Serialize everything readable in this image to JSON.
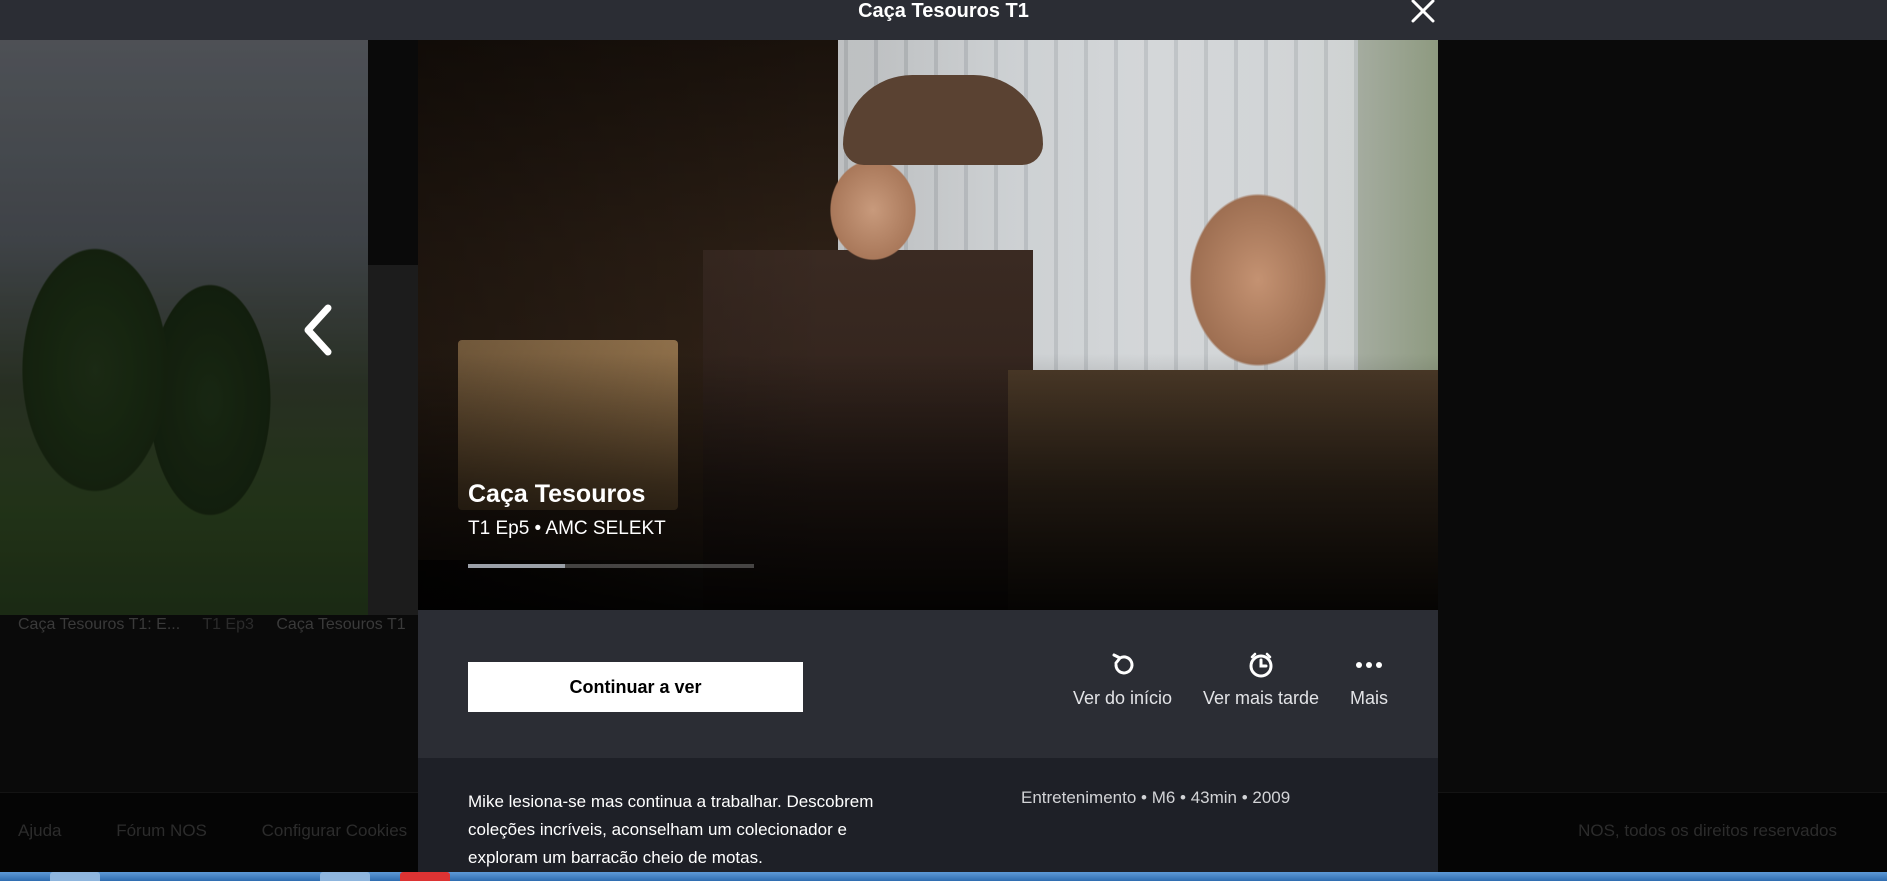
{
  "window": {
    "title": "Caça Tesouros T1",
    "close_label": "Fechar"
  },
  "background": {
    "captions": [
      "Caça Tesouros T1: E...",
      "T1 Ep3",
      "Caça Tesouros T1"
    ],
    "footer_links": [
      "Ajuda",
      "Fórum NOS",
      "Configurar Cookies"
    ],
    "copyright": "NOS, todos os direitos reservados"
  },
  "episode": {
    "show_title": "Caça Tesouros",
    "subtitle": "T1 Ep5 • AMC SELEKT",
    "progress": 0.34,
    "continue_label": "Continuar a ver",
    "actions": [
      {
        "label": "Ver do início",
        "icon": "replay-icon"
      },
      {
        "label": "Ver mais tarde",
        "icon": "watch-later-icon"
      },
      {
        "label": "Mais",
        "icon": "more-icon"
      }
    ],
    "description": "Mike lesiona-se mas continua a trabalhar. Descobrem coleções incríveis, aconselham um colecionador e exploram um barracão cheio de motas.",
    "meta": "Entretenimento • M6 • 43min • 2009"
  },
  "colors": {
    "topbar": "#2b2d34",
    "modal": "#1e2027",
    "button_bg": "#ffffff"
  }
}
